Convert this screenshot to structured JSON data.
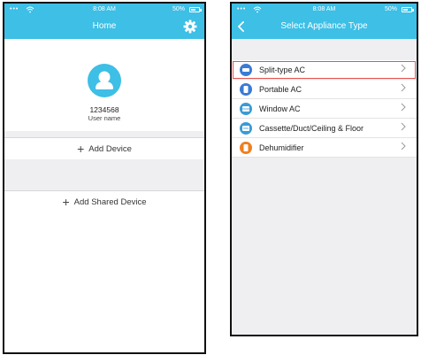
{
  "home_screen": {
    "status": {
      "dots": "•••",
      "time": "8:08 AM",
      "battery": "50%"
    },
    "title": "Home",
    "user_id": "1234568",
    "user_name": "User name",
    "add_device_label": "Add Device",
    "add_shared_device_label": "Add Shared Device",
    "accent_color": "#3dbfe6"
  },
  "select_screen": {
    "status": {
      "dots": "•••",
      "time": "8:08 AM",
      "battery": "50%"
    },
    "title": "Select Appliance Type",
    "appliances": [
      {
        "label": "Split-type AC",
        "icon": "split-ac-icon",
        "color": "#3a7bd5",
        "selected": true
      },
      {
        "label": "Portable AC",
        "icon": "portable-ac-icon",
        "color": "#3a7bd5",
        "selected": false
      },
      {
        "label": "Window AC",
        "icon": "window-ac-icon",
        "color": "#3a9bd5",
        "selected": false
      },
      {
        "label": "Cassette/Duct/Ceiling & Floor",
        "icon": "cassette-ac-icon",
        "color": "#3a9bd5",
        "selected": false
      },
      {
        "label": "Dehumidifier",
        "icon": "dehumidifier-icon",
        "color": "#f07f1f",
        "selected": false
      }
    ],
    "highlight_color": "#e8534f"
  }
}
